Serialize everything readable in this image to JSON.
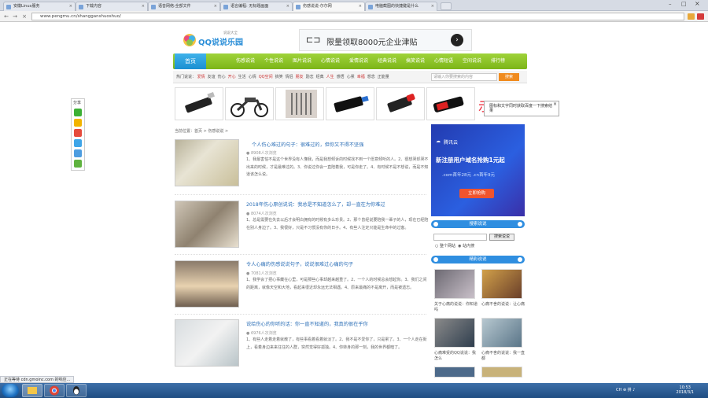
{
  "browser": {
    "tabs": [
      {
        "label": "安徽Linux服务",
        "active": false
      },
      {
        "label": "下载内容",
        "active": false
      },
      {
        "label": "语音网络:全部文件",
        "active": false
      },
      {
        "label": "语言编程: 无标题画面",
        "active": false
      },
      {
        "label": "伤感说说-尔尔网",
        "active": true
      },
      {
        "label": "电脑截图的快捷键是什么",
        "active": false
      }
    ],
    "url": "www.pengmu.cn/shangganshuoshuo/"
  },
  "site": {
    "logo_text": "QQ说说乐园",
    "logo_sub": "说说大全",
    "ad_top_text": "限量领取8000元企业津贴",
    "nav_home": "首页",
    "nav_items": [
      "伤感说说",
      "个性说说",
      "图片说说",
      "心情说说",
      "爱情说说",
      "经典说说",
      "搞笑说说",
      "心情短语",
      "空间说说",
      "排行榜"
    ],
    "subnav_label": "热门说说：",
    "subnav_tags": [
      "爱情",
      "友谊",
      "伤心",
      "开心",
      "生活",
      "心情",
      "QQ空间",
      "搞笑",
      "情侣",
      "朋友",
      "励志",
      "经典",
      "人生",
      "感悟",
      "心累",
      "幸福",
      "想念",
      "正能量"
    ],
    "search_placeholder": "请输入你要搜索的内容",
    "search_button": "搜索",
    "tooltip_text": "图标和文字同时获取百度一下搜索结果"
  },
  "breadcrumb": "当前位置：首页 > 伤感说说 >",
  "articles": [
    {
      "title": "个人伤心难过的句子：很难过的，但你又不得不坚强",
      "reads": "8908人次浏览",
      "body": "1、我最害怕不是这个世界没有人懂我，而是我想倾诉的时候找不到一个愿意倾听的人。2、很想哭却哭不出来的时候，才是最难过的。3、你说过你会一直陪着我，可是你走了。4、有时候不是不想说，而是不知道该怎么说。"
    },
    {
      "title": "2018年伤心原创说说：我总是不知道怎么了，却一直在为你难过",
      "reads": "8074人次浏览",
      "body": "1、总是需要在失去以后才会明白拥有的时候有多么珍贵。2、那个曾经说要陪我一辈子的人，现在已经陪在别人身边了。3、我很好，只是不习惯没有你的日子。4、有些人注定只能是生命中的过客。"
    },
    {
      "title": "令人心痛的伤感说说句子，说说很难过心痛的句子",
      "reads": "7081人次浏览",
      "body": "1、我学会了把心事藏在心里，可是那些心事却越来越重了。2、一个人的时候总会想起你。3、我们之间的距离，就像天空和大地，看起来很近却永远无法相遇。4、原来最痛的不是离开，而是被遗忘。"
    },
    {
      "title": "说给伤心的你听的话：你一直不知道的，我真的很在乎你",
      "reads": "6976人次浏览",
      "body": "1、有些人走着走着就散了，有些事看着看着就淡了。2、我不是不爱你了，只是累了。3、一个人走在街上，看着身边来来往往的人群，突然觉得好孤独。4、你转身的那一刻，我的世界都暗了。"
    }
  ],
  "sidebar": {
    "ad_brand": "腾讯云",
    "ad_headline": "新注册用户域名抢购1元起",
    "ad_prices": ".com首年28元 .cn首年9元",
    "ad_button": "立即抢购",
    "search_title": "搜索说说",
    "search_button": "搜索说说",
    "radio_1": "整个网站",
    "radio_2": "站内搜",
    "recommend_title": "精彩说说",
    "recommend_items": [
      {
        "caption": "关于心痛的说说：你知道吗"
      },
      {
        "caption": "心痛不舍的说说：让心痛"
      },
      {
        "caption": "心痛难受的QQ说说：我怎么"
      },
      {
        "caption": "心痛不舍的说说：我一直都"
      }
    ]
  },
  "status_text": "正在等待 cdn.gmoinc.com 的响应...",
  "clock": {
    "time": "10:53",
    "date": "2018/3/1"
  },
  "tray_text": "CH ⊕ 拼 ♪"
}
